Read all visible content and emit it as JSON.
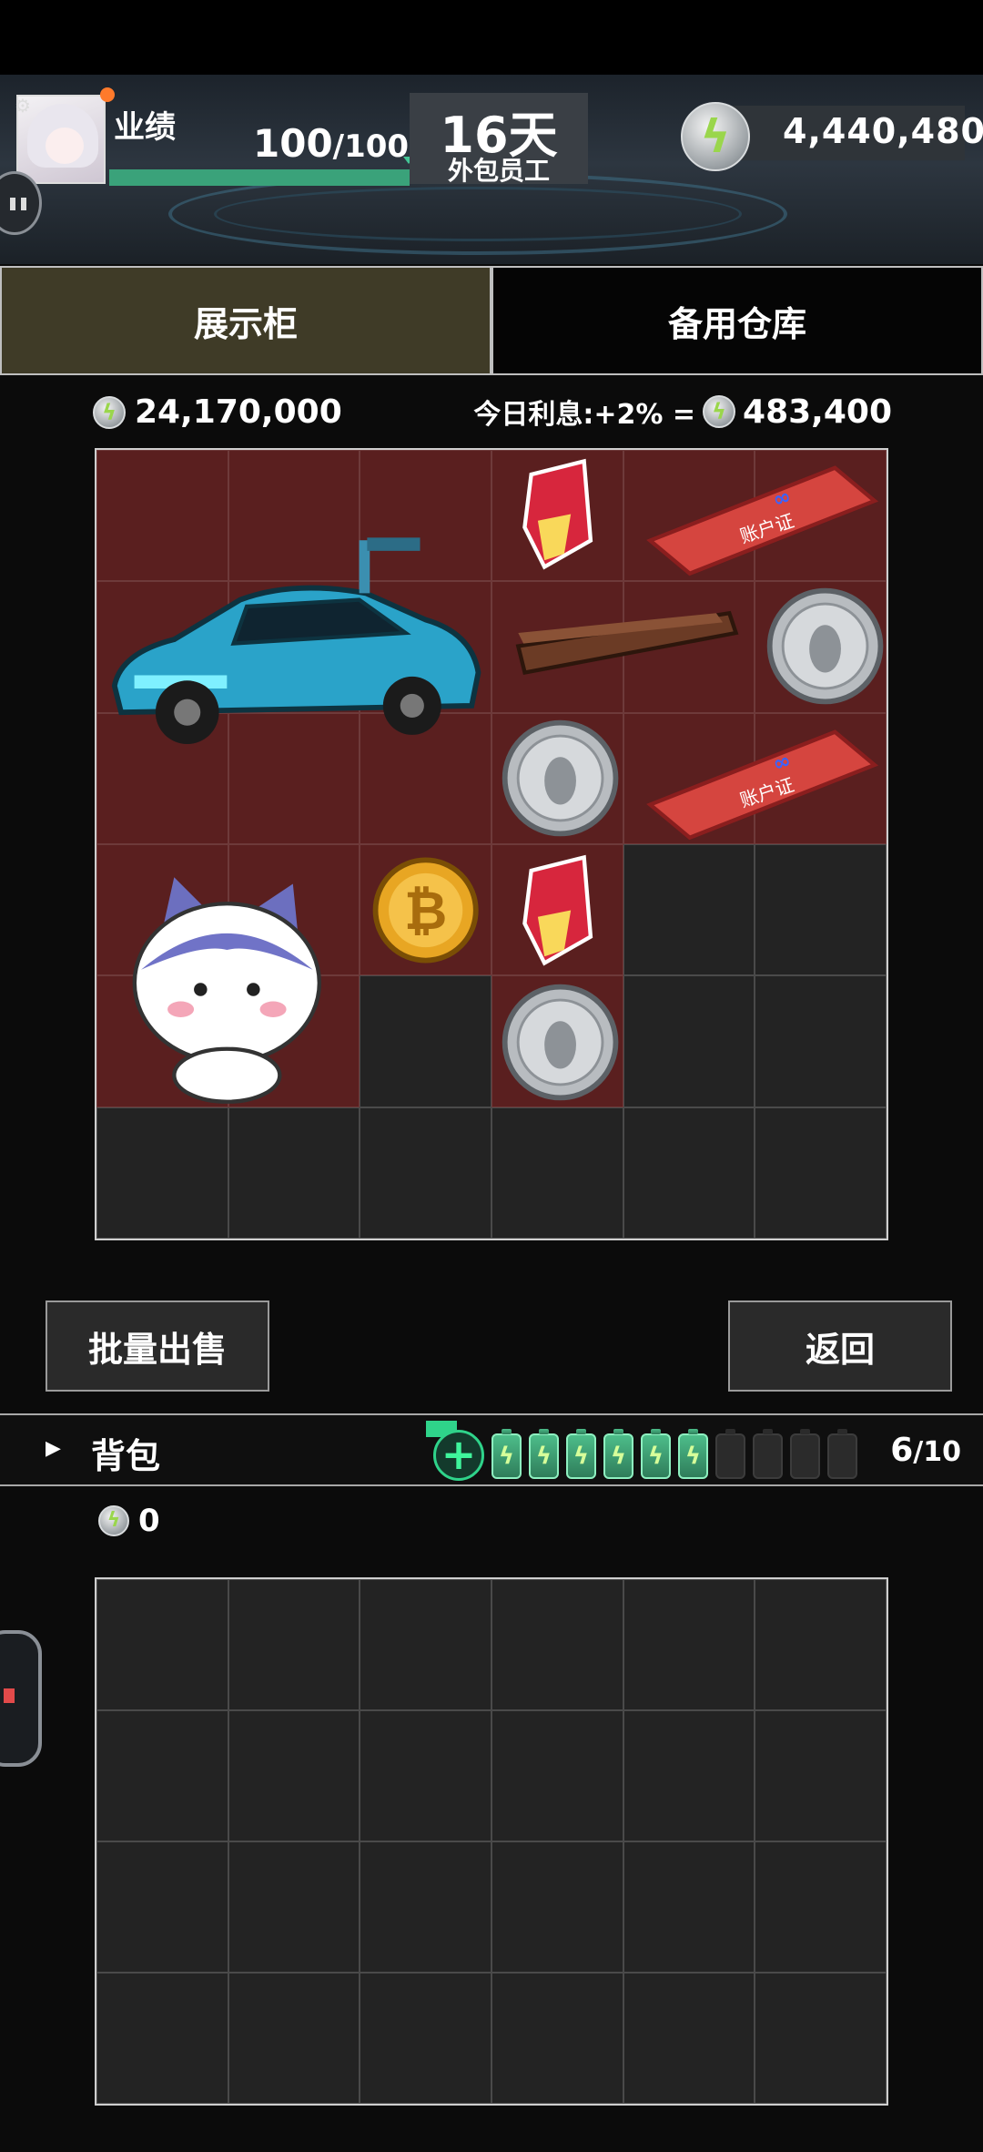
{
  "header": {
    "performance_label": "业绩",
    "performance_current": "100",
    "performance_max": "/100",
    "performance_ratio": 1.0,
    "days": "16天",
    "role": "外包员工",
    "balance": "4,440,480"
  },
  "tabs": [
    {
      "label": "展示柜",
      "active": true
    },
    {
      "label": "备用仓库",
      "active": false
    }
  ],
  "showcase": {
    "total_value": "24,170,000",
    "interest_label": "今日利息:+2% =",
    "interest_amount": "483,400",
    "grid_cols": 6,
    "grid_rows": 6,
    "items": [
      {
        "name": "sports-car",
        "col": 0,
        "row": 0,
        "w": 3,
        "h": 3
      },
      {
        "name": "red-crystal",
        "col": 3,
        "row": 0,
        "w": 1,
        "h": 1
      },
      {
        "name": "meta-account-card",
        "col": 4,
        "row": 0,
        "w": 2,
        "h": 1,
        "text": "账户证"
      },
      {
        "name": "brown-stick",
        "col": 3,
        "row": 1,
        "w": 2,
        "h": 1
      },
      {
        "name": "silver-penguin-coin",
        "col": 5,
        "row": 1,
        "w": 1,
        "h": 1
      },
      {
        "name": "silver-penguin-coin",
        "col": 3,
        "row": 2,
        "w": 1,
        "h": 1
      },
      {
        "name": "meta-account-card",
        "col": 4,
        "row": 2,
        "w": 2,
        "h": 1,
        "text": "账户证"
      },
      {
        "name": "cat-plush",
        "col": 0,
        "row": 3,
        "w": 2,
        "h": 2
      },
      {
        "name": "bitcoin",
        "col": 2,
        "row": 3,
        "w": 1,
        "h": 1
      },
      {
        "name": "red-crystal",
        "col": 3,
        "row": 3,
        "w": 1,
        "h": 1
      },
      {
        "name": "silver-penguin-coin",
        "col": 3,
        "row": 4,
        "w": 1,
        "h": 1
      }
    ]
  },
  "actions": {
    "bulk_sell": "批量出售",
    "back": "返回"
  },
  "backpack": {
    "label": "背包",
    "charges_full": 6,
    "charges_total": 10,
    "count": "6",
    "max": "/10",
    "value": "0",
    "grid_cols": 6,
    "grid_rows": 4
  },
  "colors": {
    "filled_cell": "#5a1f1f",
    "empty_cell": "#232323",
    "active_tab": "#3f3b27",
    "accent_green": "#2fd38a"
  }
}
